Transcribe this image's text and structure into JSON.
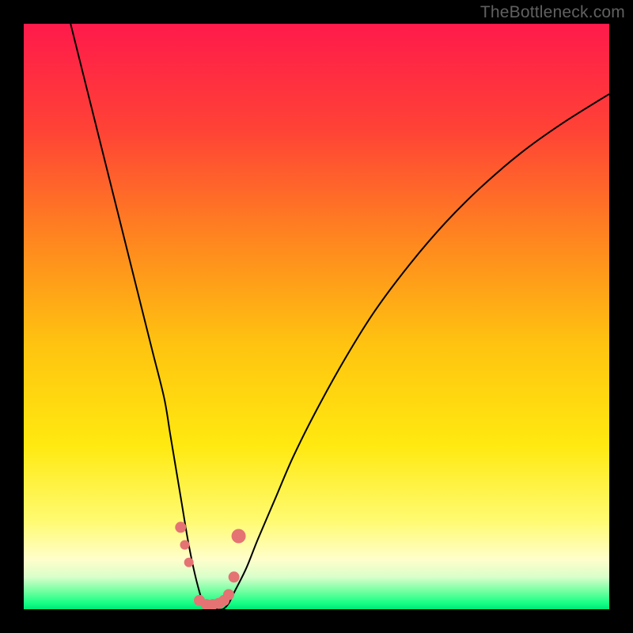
{
  "watermark": "TheBottleneck.com",
  "colors": {
    "frame": "#000000",
    "curve": "#000000",
    "marker": "#e57373",
    "gradient_stops": [
      {
        "offset": 0.0,
        "color": "#ff1a4b"
      },
      {
        "offset": 0.18,
        "color": "#ff4236"
      },
      {
        "offset": 0.38,
        "color": "#ff8a1e"
      },
      {
        "offset": 0.55,
        "color": "#ffc410"
      },
      {
        "offset": 0.72,
        "color": "#ffe910"
      },
      {
        "offset": 0.85,
        "color": "#fffb72"
      },
      {
        "offset": 0.915,
        "color": "#fffecb"
      },
      {
        "offset": 0.945,
        "color": "#d8ffca"
      },
      {
        "offset": 0.97,
        "color": "#6fffa0"
      },
      {
        "offset": 0.99,
        "color": "#13ff84"
      },
      {
        "offset": 1.0,
        "color": "#00e67a"
      }
    ]
  },
  "chart_data": {
    "type": "line",
    "title": "",
    "xlabel": "",
    "ylabel": "",
    "xlim": [
      0,
      100
    ],
    "ylim": [
      0,
      100
    ],
    "grid": false,
    "series": [
      {
        "name": "bottleneck-curve",
        "x": [
          8,
          10,
          12,
          14,
          16,
          18,
          20,
          22,
          24,
          25,
          26,
          27,
          28,
          29,
          30,
          31,
          32,
          33,
          34,
          35,
          36,
          38,
          40,
          43,
          46,
          50,
          55,
          60,
          66,
          72,
          78,
          85,
          92,
          100
        ],
        "y": [
          100,
          92,
          84,
          76,
          68,
          60,
          52,
          44,
          36,
          30,
          24,
          18,
          12,
          7,
          3,
          0,
          0,
          0,
          0,
          1,
          3,
          7,
          12,
          19,
          26,
          34,
          43,
          51,
          59,
          66,
          72,
          78,
          83,
          88
        ]
      }
    ],
    "markers": {
      "name": "highlight-dots",
      "x": [
        26.8,
        27.5,
        28.2,
        30.0,
        31.2,
        32.3,
        33.3,
        34.2,
        35.0,
        35.9,
        36.7
      ],
      "y": [
        14,
        11,
        8,
        1.5,
        0.8,
        0.8,
        1.0,
        1.5,
        2.5,
        5.5,
        12.5
      ],
      "r": [
        7,
        6,
        6,
        7,
        7,
        7,
        7,
        7,
        7,
        7,
        9
      ]
    }
  }
}
